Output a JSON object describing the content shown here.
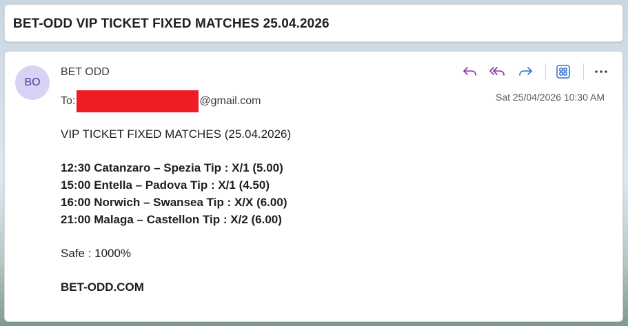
{
  "subject": "BET-ODD VIP TICKET FIXED MATCHES 25.04.2026",
  "sender": {
    "initials": "BO",
    "name": "BET ODD"
  },
  "recipient": {
    "label": "To:",
    "domain": "@gmail.com"
  },
  "date": "Sat 25/04/2026 10:30 AM",
  "actions": [
    "reply",
    "reply-all",
    "forward",
    "apps",
    "more"
  ],
  "accent_color": "#8a2ea3",
  "body": {
    "heading": "VIP TICKET FIXED MATCHES (25.04.2026)",
    "matches": [
      "12:30  Catanzaro – Spezia  Tip : X/1 (5.00)",
      "15:00  Entella – Padova  Tip : X/1 (4.50)",
      "16:00  Norwich – Swansea   Tip : X/X (6.00)",
      "21:00  Malaga – Castellon  Tip : X/2 (6.00)"
    ],
    "safe": "Safe : 1000%",
    "site": "BET-ODD.COM"
  }
}
